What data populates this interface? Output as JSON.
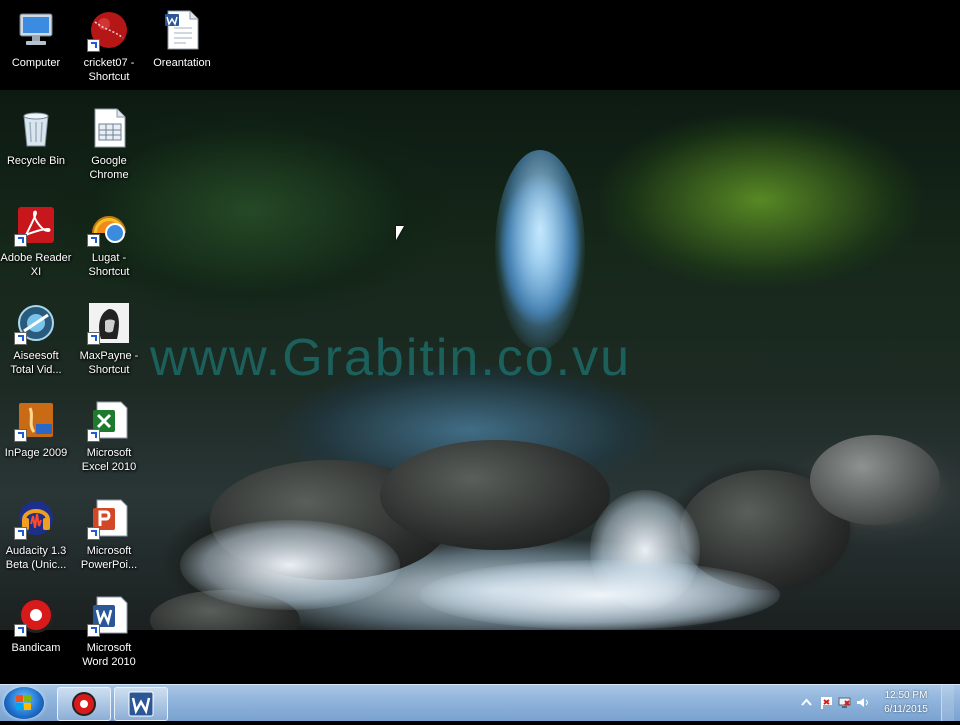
{
  "desktop": {
    "icons": [
      {
        "label": "Computer",
        "icon": "computer-icon",
        "shortcut": false
      },
      {
        "label": "cricket07 -\nShortcut",
        "icon": "cricket-ball-icon",
        "shortcut": true
      },
      {
        "label": "Oreantation",
        "icon": "word-document-icon",
        "shortcut": false
      },
      {
        "label": "Recycle Bin",
        "icon": "recycle-bin-icon",
        "shortcut": false
      },
      {
        "label": "Google\nChrome",
        "icon": "chrome-document-icon",
        "shortcut": false
      },
      {
        "label": "Adobe Reader\nXI",
        "icon": "adobe-reader-icon",
        "shortcut": true
      },
      {
        "label": "Lugat -\nShortcut",
        "icon": "lugat-icon",
        "shortcut": true
      },
      {
        "label": "Aiseesoft\nTotal Vid...",
        "icon": "aiseesoft-icon",
        "shortcut": true
      },
      {
        "label": "MaxPayne -\nShortcut",
        "icon": "maxpayne-icon",
        "shortcut": true
      },
      {
        "label": "InPage 2009",
        "icon": "inpage-icon",
        "shortcut": true
      },
      {
        "label": "Microsoft\nExcel 2010",
        "icon": "excel-icon",
        "shortcut": true
      },
      {
        "label": "Audacity 1.3\nBeta (Unic...",
        "icon": "audacity-icon",
        "shortcut": true
      },
      {
        "label": "Microsoft\nPowerPoi...",
        "icon": "powerpoint-icon",
        "shortcut": true
      },
      {
        "label": "Bandicam",
        "icon": "bandicam-icon",
        "shortcut": true
      },
      {
        "label": "Microsoft\nWord 2010",
        "icon": "word-icon",
        "shortcut": true
      }
    ],
    "watermark": "www.Grabitin.co.vu"
  },
  "taskbar": {
    "start_icon": "windows-logo-icon",
    "pinned": [
      {
        "icon": "bandicam-icon"
      },
      {
        "icon": "word-icon"
      }
    ],
    "tray_icons": [
      "show-hidden-icons-icon",
      "action-center-flag-icon",
      "network-icon",
      "volume-icon"
    ],
    "clock": {
      "time": "12:50 PM",
      "date": "6/11/2015"
    }
  },
  "colors": {
    "taskbar_top": "#a9c6e6",
    "taskbar_bottom": "#7aa2cf",
    "watermark": "#1e8c8c"
  }
}
